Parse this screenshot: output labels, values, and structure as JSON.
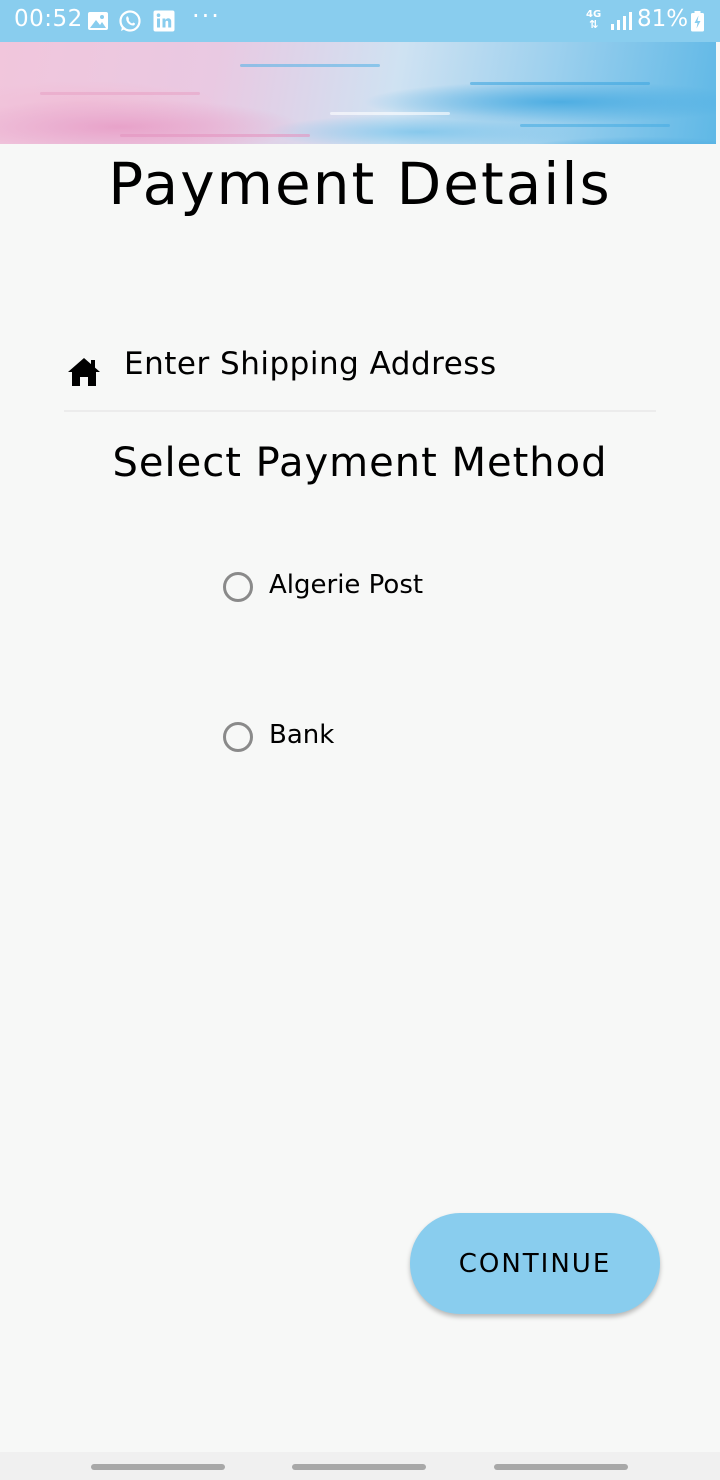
{
  "status_bar": {
    "time": "00:52",
    "network": "4G",
    "battery": "81%",
    "more": "···",
    "icons": [
      "image-icon",
      "whatsapp-icon",
      "linkedin-icon",
      "signal-icon",
      "battery-charging-icon"
    ]
  },
  "header": {
    "title": "Payment Details"
  },
  "shipping": {
    "placeholder": "Enter Shipping Address",
    "icon": "home-icon"
  },
  "payment": {
    "title": "Select Payment Method",
    "options": [
      {
        "label": "Algerie Post",
        "selected": false
      },
      {
        "label": "Bank",
        "selected": false
      }
    ]
  },
  "actions": {
    "continue_label": "CONTINUE"
  },
  "colors": {
    "accent": "#89cdee",
    "background": "#f7f8f7",
    "radio_border": "#8a8a8a"
  }
}
